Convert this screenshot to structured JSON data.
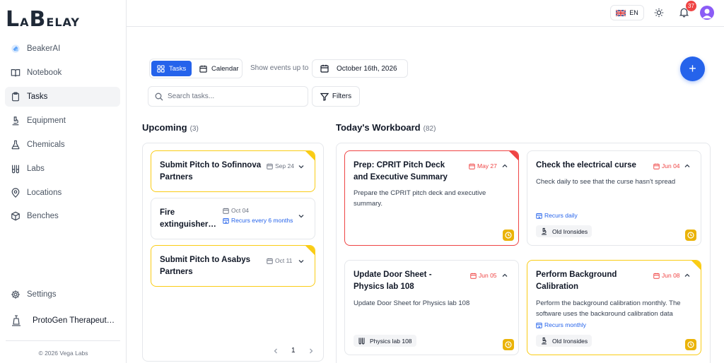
{
  "app": {
    "logo_big_l": "L",
    "logo_small_a": "A",
    "logo_big_b": "B",
    "logo_small_rest": "ELAY"
  },
  "sidebar": {
    "items": [
      {
        "label": "BeakerAI",
        "icon": "beaker-ai-icon"
      },
      {
        "label": "Notebook",
        "icon": "book-open-icon"
      },
      {
        "label": "Tasks",
        "icon": "clipboard-icon",
        "active": true
      },
      {
        "label": "Equipment",
        "icon": "microscope-icon"
      },
      {
        "label": "Chemicals",
        "icon": "flask-icon"
      },
      {
        "label": "Labs",
        "icon": "test-tubes-icon"
      },
      {
        "label": "Locations",
        "icon": "map-pin-icon"
      },
      {
        "label": "Benches",
        "icon": "box-icon"
      }
    ],
    "settings_label": "Settings",
    "org_name": "ProtoGen Therapeutics",
    "copyright": "© 2026 Vega Labs"
  },
  "topbar": {
    "language": "EN",
    "notification_count": "37"
  },
  "toolbar": {
    "tab_tasks": "Tasks",
    "tab_calendar": "Calendar",
    "show_events_label": "Show events up to",
    "date_value": "October 16th, 2026",
    "add_label": "+",
    "search_placeholder": "Search tasks...",
    "filters_label": "Filters"
  },
  "upcoming": {
    "title": "Upcoming",
    "count": "(3)",
    "cards": [
      {
        "title": "Submit Pitch to Sofinnova Partners",
        "date": "Sep 24"
      },
      {
        "title": "Fire extinguisher…",
        "date": "Oct 04",
        "recur": "Recurs every 6 months"
      },
      {
        "title": "Submit Pitch to Asabys Partners",
        "date": "Oct 11"
      }
    ],
    "page": "1"
  },
  "workboard": {
    "title": "Today's Workboard",
    "count": "(82)",
    "cards": [
      {
        "title": "Prep: CPRIT Pitch Deck and Executive Summary",
        "date": "May 27",
        "desc": "Prepare the CPRIT pitch deck and executive summary."
      },
      {
        "title": "Check the electrical curse",
        "date": "Jun 04",
        "desc": "Check daily to see that the curse hasn't spread",
        "recur": "Recurs daily",
        "tag": "Old Ironsides"
      },
      {
        "title": "Update Door Sheet - Physics lab 108",
        "date": "Jun 05",
        "desc": "Update Door Sheet for Physics lab 108",
        "tag": "Physics lab 108"
      },
      {
        "title": "Perform Background Calibration",
        "date": "Jun 08",
        "desc": "Perform the background calibration monthly. The software uses the background calibration data",
        "recur": "Recurs monthly",
        "tag": "Old Ironsides"
      }
    ]
  },
  "colors": {
    "accent": "#2563eb",
    "overdue": "#ef4444",
    "warning": "#facc15"
  }
}
